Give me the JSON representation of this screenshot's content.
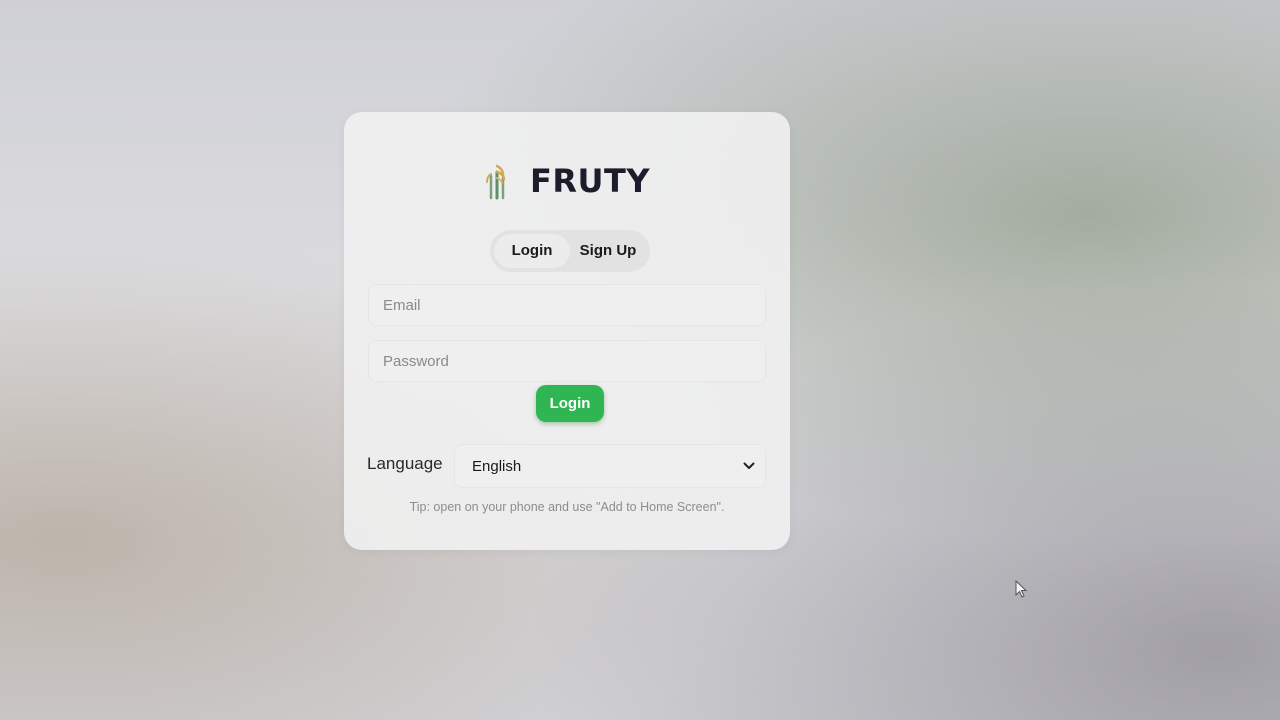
{
  "app": {
    "name": "FRUTY",
    "logo_icon": "wheat-logo-icon"
  },
  "tabs": [
    {
      "label": "Login",
      "active": true
    },
    {
      "label": "Sign Up",
      "active": false
    }
  ],
  "form": {
    "email_placeholder": "Email",
    "password_placeholder": "Password",
    "submit_label": "Login"
  },
  "language": {
    "label": "Language",
    "selected": "English"
  },
  "tip": "Tip: open on your phone and use \"Add to Home Screen\".",
  "colors": {
    "accent": "#2fb552",
    "text": "#1b1d2b"
  }
}
